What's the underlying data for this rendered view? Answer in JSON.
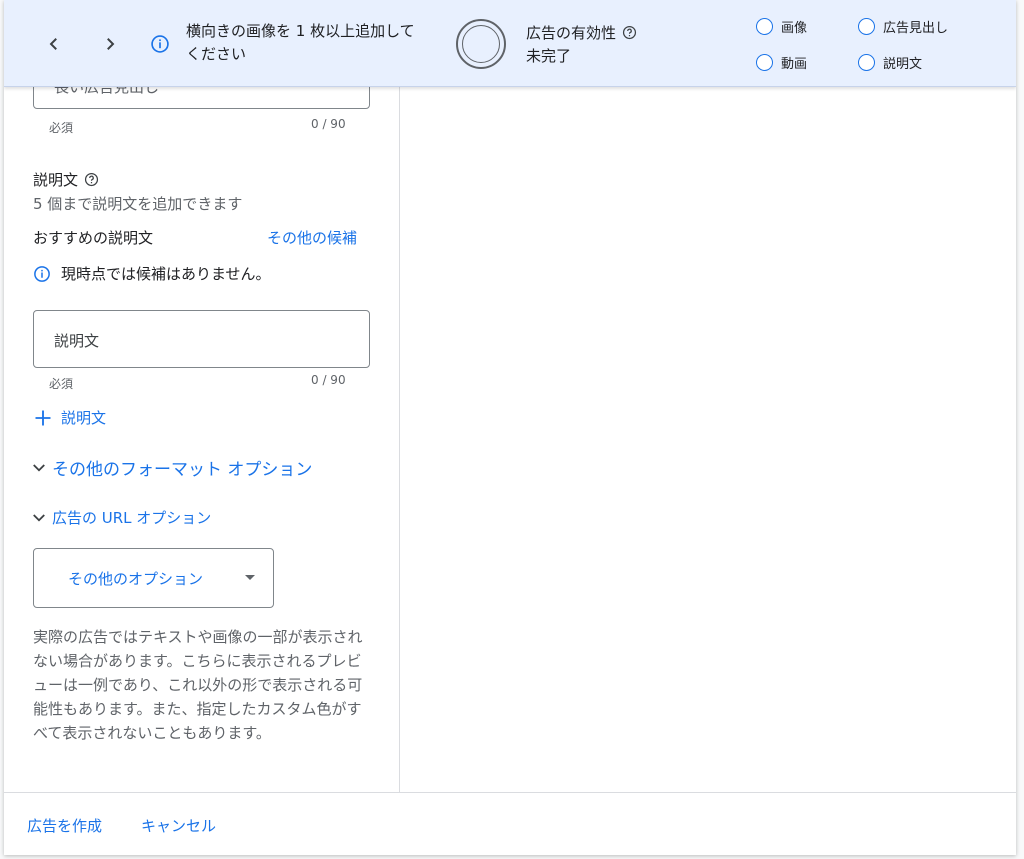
{
  "banner": {
    "message": "横向きの画像を 1 枚以上追加してください",
    "effectiveness_label": "広告の有効性",
    "effectiveness_status": "未完了",
    "checklist": [
      {
        "label": "画像"
      },
      {
        "label": "広告見出し"
      },
      {
        "label": "動画"
      },
      {
        "label": "説明文"
      }
    ]
  },
  "long_headline": {
    "placeholder_partial": "長い広告見出し",
    "required": "必須",
    "counter": "0 / 90"
  },
  "description": {
    "title": "説明文",
    "subtitle": "5 個まで説明文を追加できます",
    "recommended_label": "おすすめの説明文",
    "more_link": "その他の候補",
    "no_suggestions": "現時点では候補はありません。",
    "field_placeholder": "説明文",
    "required": "必須",
    "counter": "0 / 90",
    "add_label": "説明文"
  },
  "options": {
    "format_options": "その他のフォーマット オプション",
    "url_options": "広告の URL オプション",
    "dropdown_label": "その他のオプション"
  },
  "disclaimer": "実際の広告ではテキストや画像の一部が表示されない場合があります。こちらに表示されるプレビューは一例であり、これ以外の形で表示される可能性もあります。また、指定したカスタム色がすべて表示されないこともあります。",
  "footer": {
    "create": "広告を作成",
    "cancel": "キャンセル"
  },
  "colors": {
    "accent": "#1a73e8",
    "banner_bg": "#e8f0fe"
  }
}
